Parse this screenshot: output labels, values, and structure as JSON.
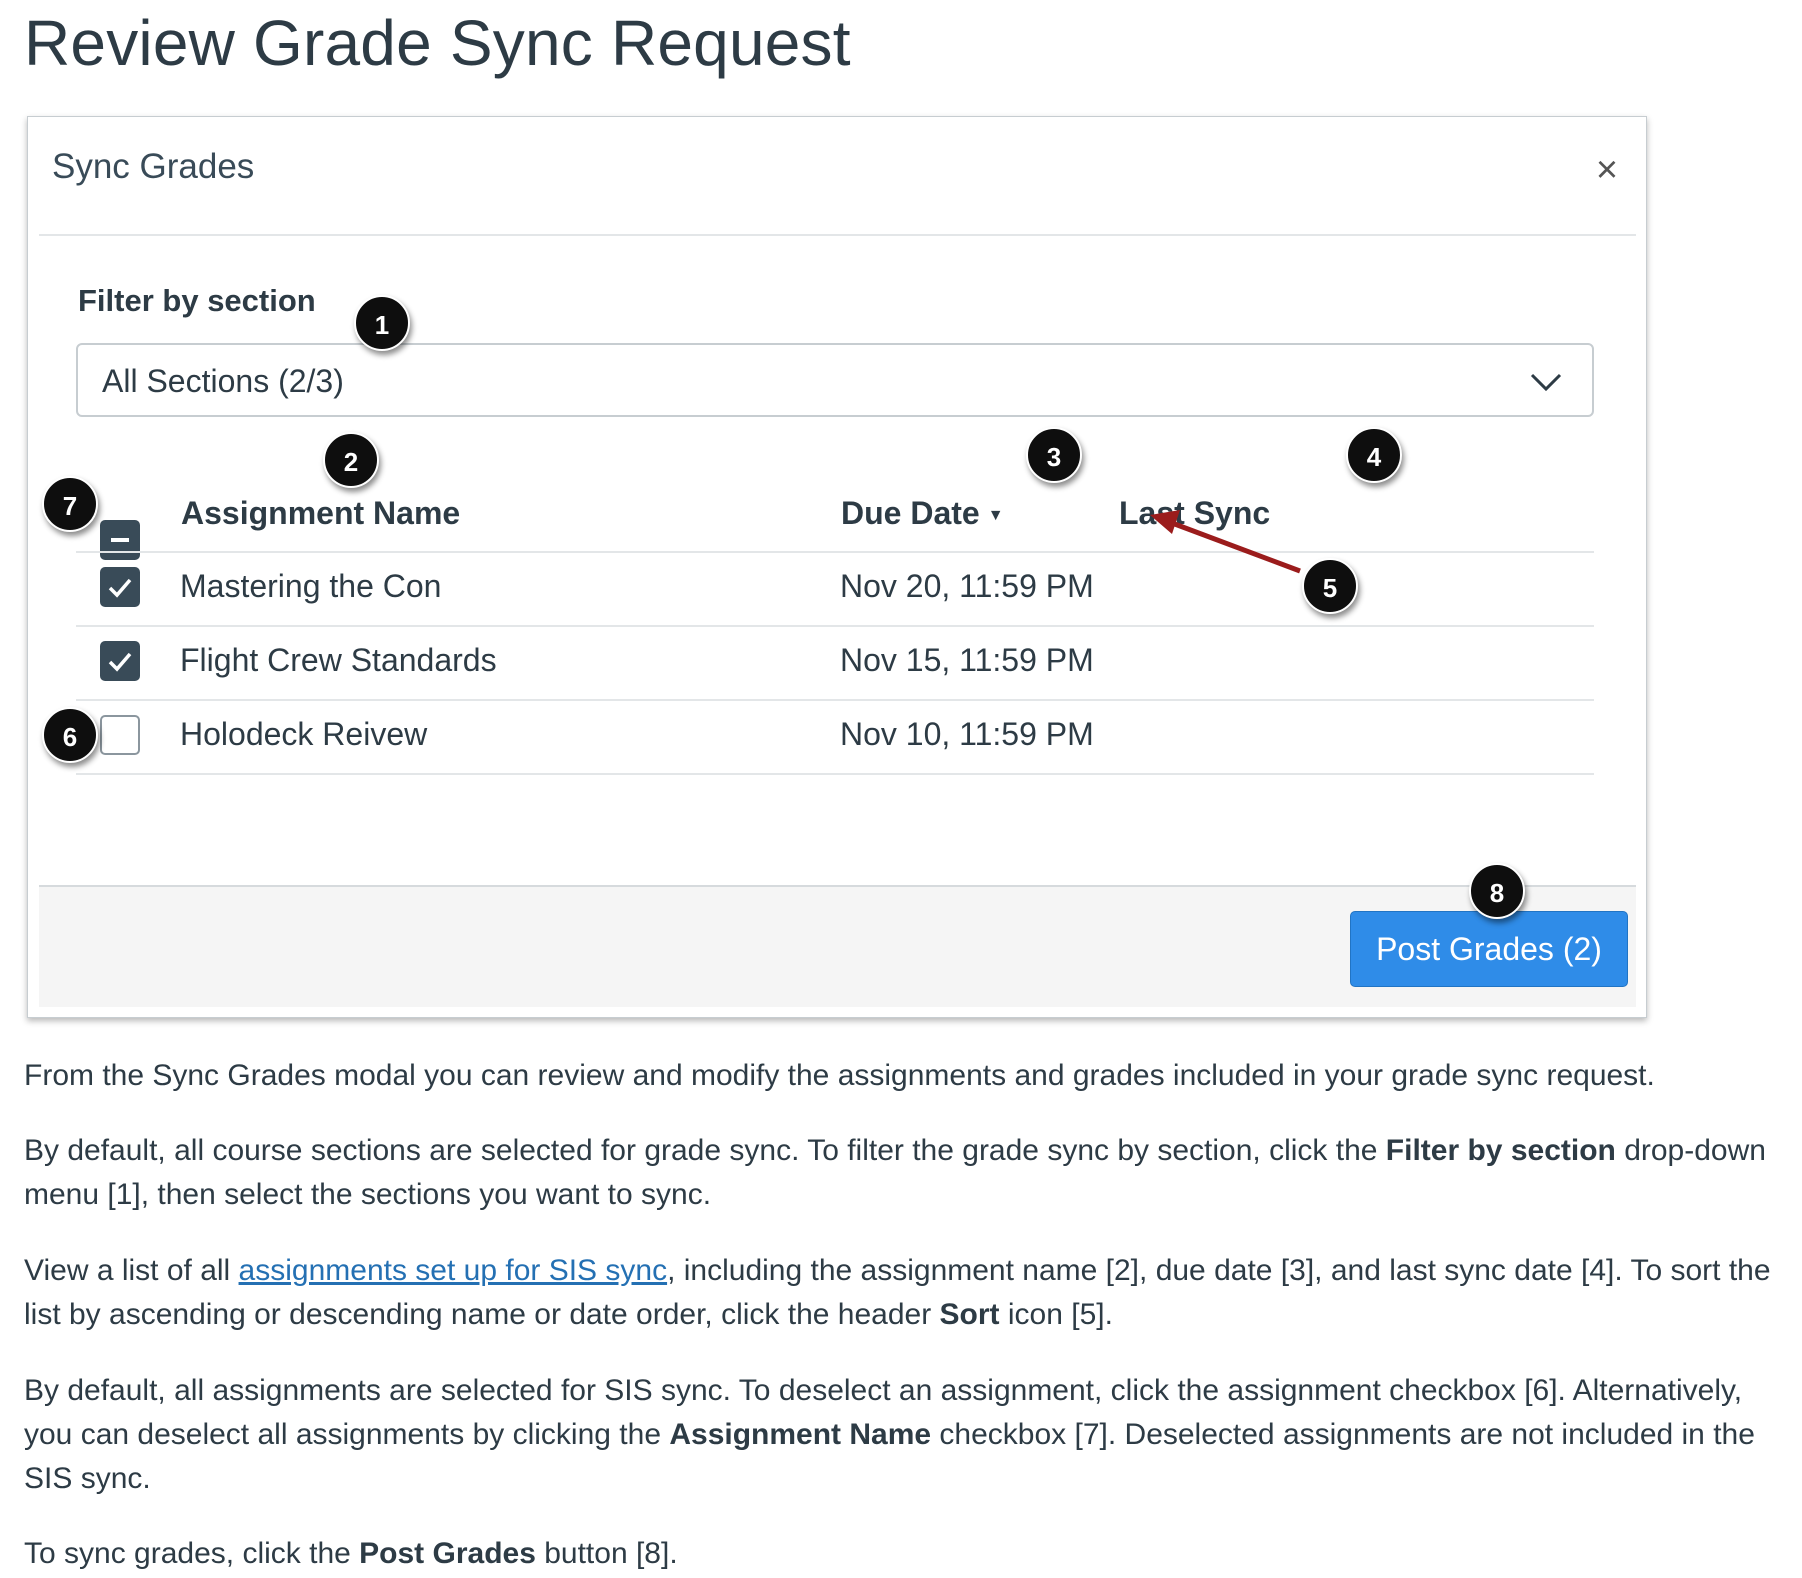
{
  "page": {
    "title": "Review Grade Sync Request"
  },
  "modal": {
    "title": "Sync Grades",
    "close_glyph": "×",
    "filter": {
      "label": "Filter by section",
      "selected": "All Sections (2/3)",
      "chevron_icon": "chevron-down-icon"
    },
    "columns": {
      "assignment_name": "Assignment Name",
      "due_date": "Due Date",
      "last_sync": "Last Sync",
      "sort_icon": "▼"
    },
    "rows": [
      {
        "name": "Mastering the Con",
        "due": "Nov 20, 11:59 PM",
        "last_sync": "",
        "checked": true
      },
      {
        "name": "Flight Crew Standards",
        "due": "Nov 15, 11:59 PM",
        "last_sync": "",
        "checked": true
      },
      {
        "name": "Holodeck Reivew",
        "due": "Nov 10, 11:59 PM",
        "last_sync": "",
        "checked": false
      }
    ],
    "post_button": "Post Grades (2)"
  },
  "callouts": [
    "1",
    "2",
    "3",
    "4",
    "5",
    "6",
    "7",
    "8"
  ],
  "colors": {
    "checkbox_checked": "#394b58",
    "post_button": "#2f8ce8",
    "arrow": "#9b1c1c",
    "link": "#2470b3"
  },
  "body": {
    "p1": "From the Sync Grades modal you can review and modify the assignments and grades included in your grade sync request.",
    "p2": {
      "t1": "By default, all course sections are selected for grade sync. To filter the grade sync by section, click the ",
      "b1": "Filter by section",
      "t2": " drop-down menu [1], then select the sections you want to sync."
    },
    "p3": {
      "t1": "View a list of all ",
      "link": "assignments set up for SIS sync",
      "t2": ", including the assignment name [2], due date [3], and last sync date [4]. To sort the list by ascending or descending name or date order, click the header ",
      "b1": "Sort",
      "t3": " icon [5]."
    },
    "p4": {
      "t1": "By default, all assignments are selected for SIS sync. To deselect an assignment, click the assignment checkbox [6]. Alternatively, you can deselect all assignments by clicking the ",
      "b1": "Assignment Name",
      "t2": " checkbox [7]. Deselected assignments are not included in the SIS sync."
    },
    "p5": {
      "t1": "To sync grades, click the ",
      "b1": "Post Grades",
      "t2": " button [8]."
    }
  }
}
